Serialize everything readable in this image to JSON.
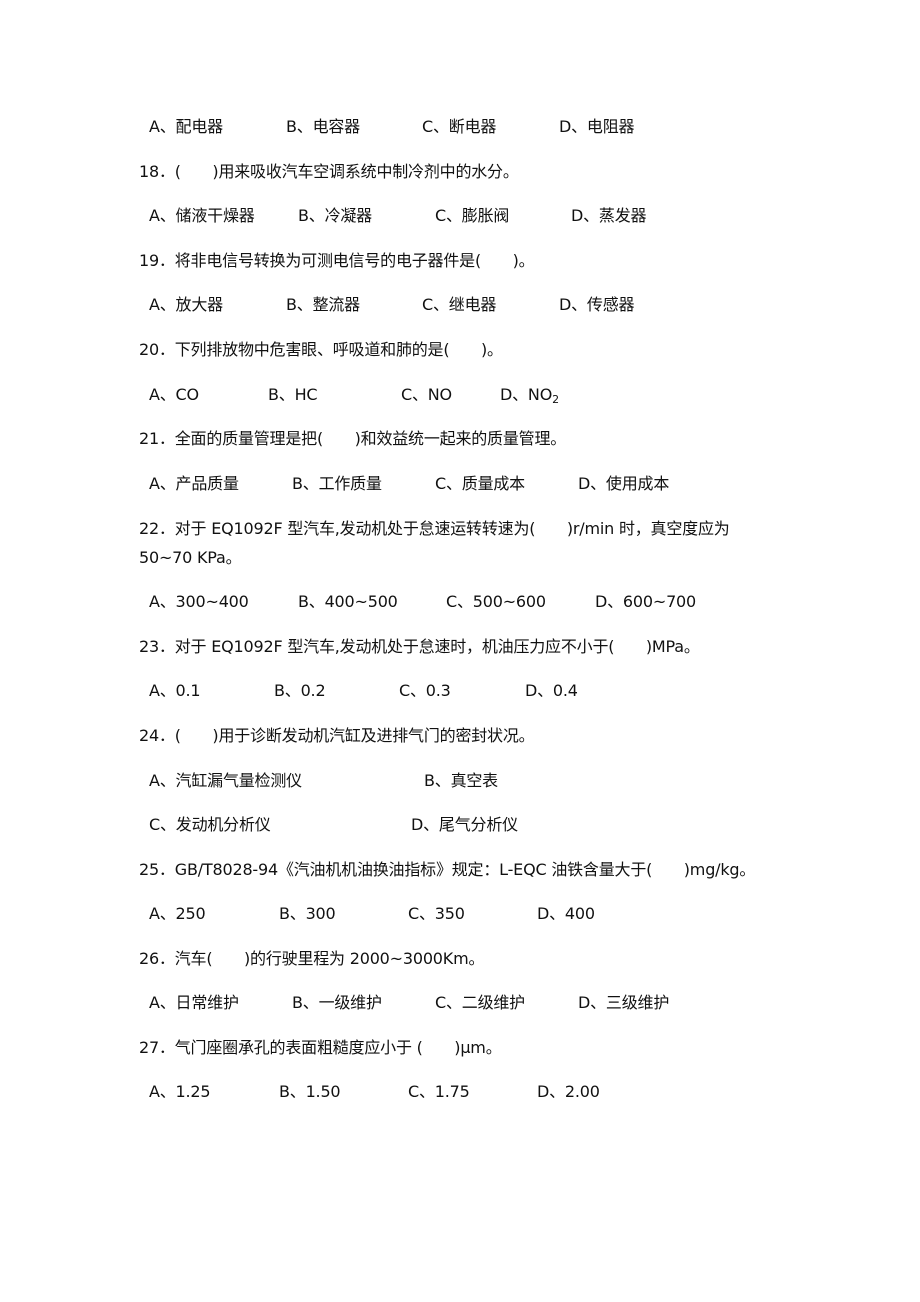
{
  "document": {
    "carryover_options": [
      "A、配电器",
      "B、电容器",
      "C、断电器",
      "D、电阻器"
    ],
    "questions": [
      {
        "number": "18",
        "text": "18．(　　)用来吸收汽车空调系统中制冷剂中的水分。",
        "options": [
          "A、储液干燥器",
          "B、冷凝器",
          "C、膨胀阀",
          "D、蒸发器"
        ]
      },
      {
        "number": "19",
        "text": "19．将非电信号转换为可测电信号的电子器件是(　　)。",
        "options": [
          "A、放大器",
          "B、整流器",
          "C、继电器",
          "D、传感器"
        ]
      },
      {
        "number": "20",
        "text": "20．下列排放物中危害眼、呼吸道和肺的是(　　)。",
        "options": [
          "A、CO",
          "B、HC",
          "C、NO",
          "D、NO"
        ],
        "option_d_subscript": "2"
      },
      {
        "number": "21",
        "text": "21．全面的质量管理是把(　　)和效益统一起来的质量管理。",
        "options": [
          "A、产品质量",
          "B、工作质量",
          "C、质量成本",
          "D、使用成本"
        ]
      },
      {
        "number": "22",
        "text": "22．对于 EQ1092F 型汽车,发动机处于怠速运转转速为(　　)r/min 时，真空度应为",
        "text_cont": "50~70 KPa。",
        "options": [
          "A、300~400",
          "B、400~500",
          "C、500~600",
          "D、600~700"
        ]
      },
      {
        "number": "23",
        "text": "23．对于 EQ1092F 型汽车,发动机处于怠速时，机油压力应不小于(　　)MPa。",
        "options": [
          "A、0.1",
          "B、0.2",
          "C、0.3",
          "D、0.4"
        ]
      },
      {
        "number": "24",
        "text": "24．(　　)用于诊断发动机汽缸及进排气门的密封状况。",
        "options": [
          "A、汽缸漏气量检测仪",
          "B、真空表",
          "C、发动机分析仪",
          "D、尾气分析仪"
        ]
      },
      {
        "number": "25",
        "text": "25．GB/T8028-94《汽油机机油换油指标》规定：L-EQC 油铁含量大于(　　)mg/kg。",
        "options": [
          "A、250",
          "B、300",
          "C、350",
          "D、400"
        ]
      },
      {
        "number": "26",
        "text": "26．汽车(　　)的行驶里程为 2000~3000Km。",
        "options": [
          "A、日常维护",
          "B、一级维护",
          "C、二级维护",
          "D、三级维护"
        ]
      },
      {
        "number": "27",
        "text": "27．气门座圈承孔的表面粗糙度应小于 (　　)μm。",
        "options": [
          "A、1.25",
          "B、1.50",
          "C、1.75",
          "D、2.00"
        ]
      }
    ]
  }
}
